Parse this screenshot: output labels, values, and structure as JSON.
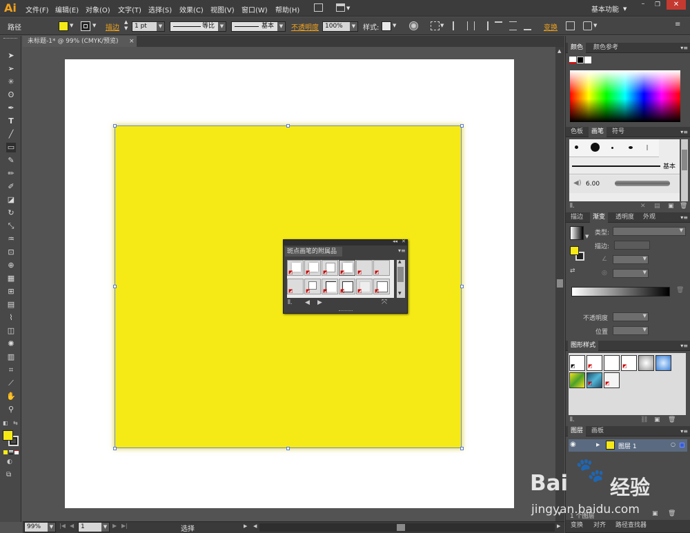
{
  "app": {
    "logo": "Ai",
    "workspace": "基本功能"
  },
  "menu": [
    "文件(F)",
    "编辑(E)",
    "对象(O)",
    "文字(T)",
    "选择(S)",
    "效果(C)",
    "视图(V)",
    "窗口(W)",
    "帮助(H)"
  ],
  "options": {
    "selection_label": "路径",
    "stroke_label": "描边",
    "stroke_weight": "1 pt",
    "profile_label": "等比",
    "brush_label": "基本",
    "opacity_label": "不透明度",
    "opacity_value": "100%",
    "style_label": "样式:",
    "transform_label": "变换"
  },
  "document": {
    "tab_title": "未标题-1* @ 99% (CMYK/预览)",
    "close": "×"
  },
  "colors": {
    "fill": "#f5ea16",
    "artboard": "#ffffff",
    "accent": "#f0a21c",
    "selection": "#5b79d6"
  },
  "panels": {
    "color_tabs": [
      "颜色",
      "颜色参考"
    ],
    "brush_tabs": [
      "色板",
      "画笔",
      "符号"
    ],
    "brush_basic": "基本",
    "brush_size": "6.00",
    "gradient_tabs": [
      "描边",
      "渐变",
      "透明度",
      "外观"
    ],
    "gradient_type": "类型:",
    "gradient_stroke": "描边:",
    "gradient_opacity": "不透明度",
    "gradient_position": "位置",
    "graphic_styles_title": "图形样式",
    "layers_tabs": [
      "图层",
      "画板"
    ],
    "layer_name": "图层 1",
    "layers_footer": "1 个图层",
    "bottom_tabs": [
      "变换",
      "对齐",
      "路径查找器"
    ]
  },
  "float_panel": {
    "title": "斑点画笔的附属品"
  },
  "status": {
    "zoom": "99%",
    "page": "1",
    "tool": "选择"
  },
  "watermark": {
    "brand": "Bai",
    "paw": "🐾",
    "brand_cn": "经验",
    "url": "jingyan.baidu.com"
  }
}
